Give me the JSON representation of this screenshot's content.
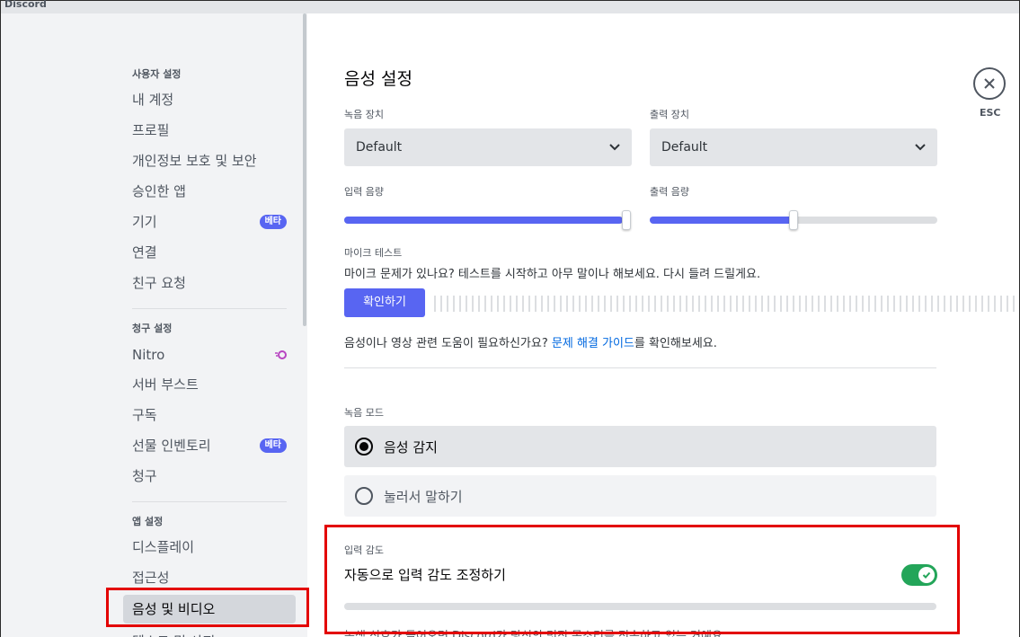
{
  "app": {
    "brand": "Discord"
  },
  "sidebar": {
    "headers": {
      "user": "사용자 설정",
      "billing": "청구 설정",
      "app": "앱 설정"
    },
    "user_items": [
      {
        "label": "내 계정"
      },
      {
        "label": "프로필"
      },
      {
        "label": "개인정보 보호 및 보안"
      },
      {
        "label": "승인한 앱"
      },
      {
        "label": "기기",
        "badge": "베타"
      },
      {
        "label": "연결"
      },
      {
        "label": "친구 요청"
      }
    ],
    "billing_items": [
      {
        "label": "Nitro"
      },
      {
        "label": "서버 부스트"
      },
      {
        "label": "구독"
      },
      {
        "label": "선물 인벤토리",
        "badge": "베타"
      },
      {
        "label": "청구"
      }
    ],
    "app_items": [
      {
        "label": "디스플레이"
      },
      {
        "label": "접근성"
      },
      {
        "label": "음성 및 비디오",
        "active": true
      },
      {
        "label": "텍스트 및 사진"
      }
    ]
  },
  "main": {
    "title": "음성 설정",
    "input_device": {
      "label": "녹음 장치",
      "value": "Default"
    },
    "output_device": {
      "label": "출력 장치",
      "value": "Default"
    },
    "input_volume": {
      "label": "입력 음량",
      "value": 1.0
    },
    "output_volume": {
      "label": "출력 음량",
      "value": 0.5
    },
    "mic_test": {
      "label": "마이크 테스트",
      "description": "마이크 문제가 있나요? 테스트를 시작하고 아무 말이나 해보세요. 다시 들려 드릴게요.",
      "button": "확인하기"
    },
    "help": {
      "prefix": "음성이나 영상 관련 도움이 필요하신가요? ",
      "link": "문제 해결 가이드",
      "suffix": "를 확인해보세요."
    },
    "input_mode": {
      "label": "녹음 모드",
      "options": [
        {
          "label": "음성 감지",
          "selected": true
        },
        {
          "label": "눌러서 말하기",
          "selected": false
        }
      ]
    },
    "sensitivity": {
      "label": "입력 감도",
      "auto_label": "자동으로 입력 감도 조정하기",
      "auto_enabled": true,
      "footnote": "녹색 신호가 들어오면 Discord가 당신의 멋진 목소리를 전송하고 있는 거예요."
    }
  },
  "close": {
    "label": "ESC"
  },
  "colors": {
    "accent": "#5865f2",
    "toggle_on": "#23a559",
    "highlight": "#e30000",
    "link": "#0068e0"
  }
}
